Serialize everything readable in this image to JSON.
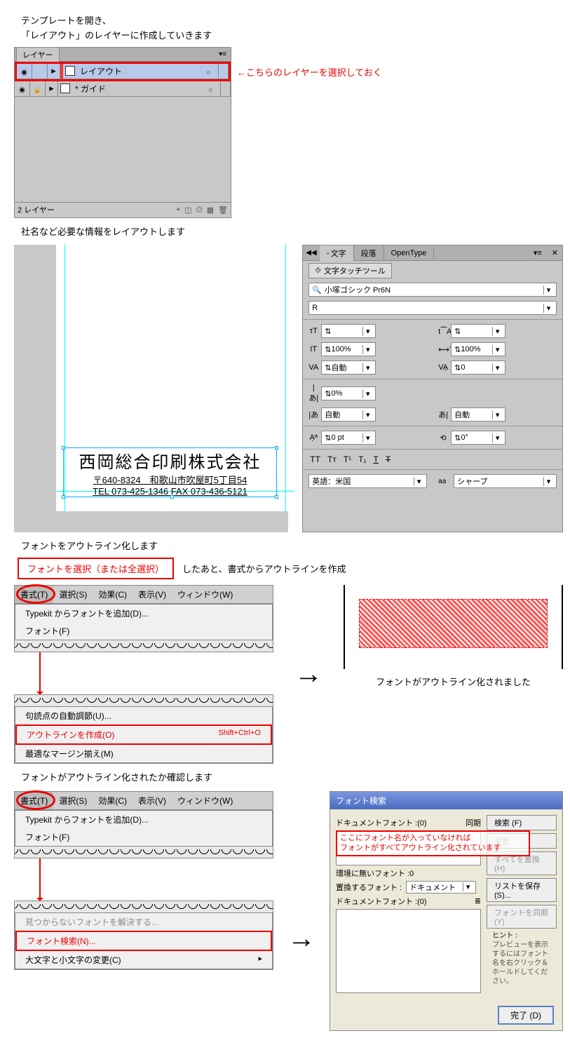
{
  "intro": {
    "line1": "テンプレートを開き、",
    "line2": "「レイアウト」のレイヤーに作成していきます"
  },
  "layers": {
    "tab": "レイヤー",
    "row1_name": "レイアウト",
    "row2_name": "* ガイド",
    "footer": "2 レイヤー",
    "callout": "←こちらのレイヤーを選択しておく"
  },
  "section2_text": "社名など必要な情報をレイアウトします",
  "company": {
    "name": "西岡総合印刷株式会社",
    "addr": "〒640-8324　和歌山市吹屋町5丁目54",
    "tel": "TEL 073-425-1346 FAX 073-436-5121"
  },
  "char_panel": {
    "tab1": "文字",
    "tab2": "段落",
    "tab3": "OpenType",
    "touch_tool": "文字タッチツール",
    "font": "小塚ゴシック Pr6N",
    "weight": "R",
    "size_pct1": "100%",
    "size_pct2": "100%",
    "autokern": "自動",
    "tracking": "0",
    "tsume": "0%",
    "aki1": "自動",
    "aki2": "自動",
    "baseline": "0 pt",
    "rotation": "0°",
    "lang": "英語：米国",
    "aa": "シャープ"
  },
  "section3_text": "フォントをアウトライン化します",
  "outline": {
    "select_text": "フォントを選択（または全選択）",
    "after_text": "したあと、書式からアウトラインを作成"
  },
  "menu": {
    "type": "書式(T)",
    "select": "選択(S)",
    "effect": "効果(C)",
    "view": "表示(V)",
    "window": "ウィンドウ(W)",
    "typekit": "Typekit からフォントを追加(D)...",
    "font": "フォント(F)",
    "punct": "句読点の自動調節(U)...",
    "outline": "アウトラインを作成(O)",
    "outline_sc": "Shift+Ctrl+O",
    "margin": "最適なマージン揃え(M)",
    "find_font": "フォント検索(N)...",
    "case": "大文字と小文字の変更(C)",
    "glyph_vis": "見つからないフォントを解決する..."
  },
  "outlined_caption": "フォントがアウトライン化されました",
  "section4_text": "フォントがアウトライン化されたか確認します",
  "font_dialog": {
    "title": "フォント検索",
    "doc_fonts": "ドキュメントフォント :(0)",
    "sync": "同期",
    "search": "検索 (F)",
    "change": "変更",
    "change_all": "すべてを置換 (H)",
    "save_list": "リストを保存 (S)...",
    "resync": "フォントを同期 (Y)",
    "missing": "環境に無いフォント :0",
    "replace_with": "置換するフォント :",
    "replace_src": "ドキュメント",
    "doc_fonts2": "ドキュメントフォント :(0)",
    "hint_title": "ヒント :",
    "hint": "プレビューを表示するにはフォント名を右クリック＆ホールドしてください。",
    "done": "完了 (D)",
    "overlay1": "ここにフォント名が入っていなければ",
    "overlay2": "フォントがすべてアウトライン化されています"
  }
}
